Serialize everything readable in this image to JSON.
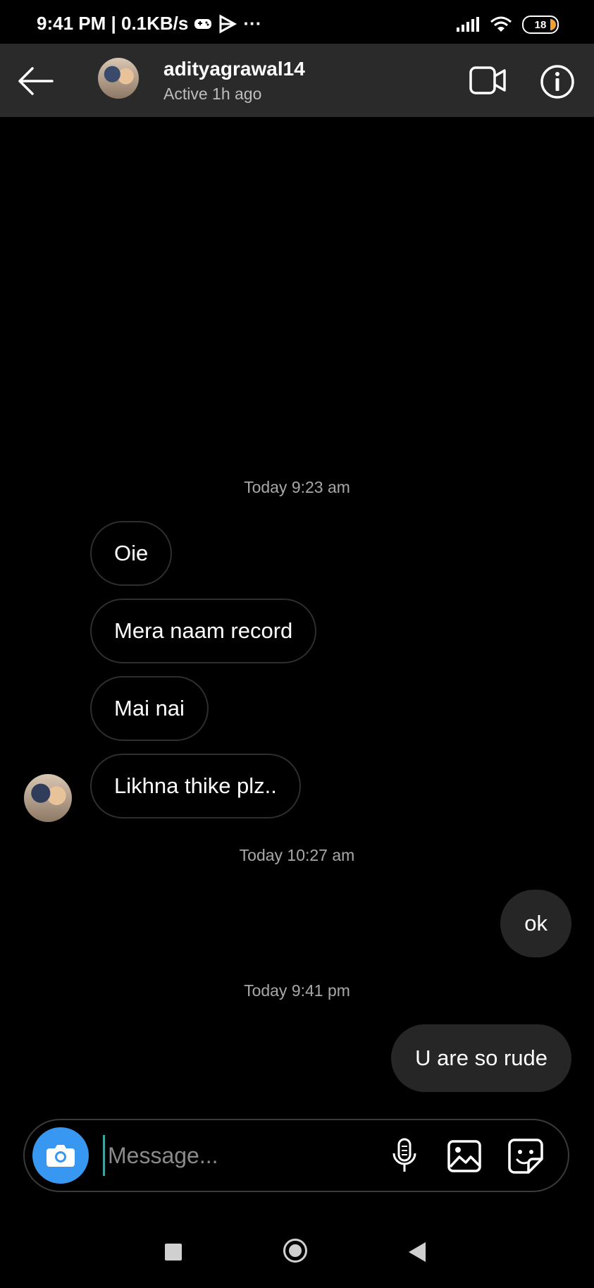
{
  "status_bar": {
    "time_speed": "9:41 PM | 0.1KB/s",
    "more": "···",
    "battery": "18"
  },
  "header": {
    "username": "adityagrawal14",
    "activity": "Active 1h ago"
  },
  "messages": [
    {
      "type": "timestamp",
      "text": "Today 9:23 am"
    },
    {
      "type": "incoming",
      "text": "Oie"
    },
    {
      "type": "incoming",
      "text": "Mera naam record"
    },
    {
      "type": "incoming",
      "text": "Mai nai"
    },
    {
      "type": "incoming",
      "text": "Likhna thike plz.."
    },
    {
      "type": "timestamp",
      "text": "Today 10:27 am"
    },
    {
      "type": "outgoing",
      "text": "ok"
    },
    {
      "type": "timestamp",
      "text": "Today 9:41 pm"
    },
    {
      "type": "outgoing",
      "text": "U are so rude"
    }
  ],
  "composer": {
    "placeholder": "Message..."
  },
  "colors": {
    "accent": "#3897f0",
    "header_bg": "#2a2a2a",
    "outgoing_bubble": "#262626"
  },
  "icons": [
    "back-arrow-icon",
    "video-camera-icon",
    "info-icon",
    "camera-icon",
    "microphone-icon",
    "gallery-icon",
    "sticker-icon"
  ]
}
